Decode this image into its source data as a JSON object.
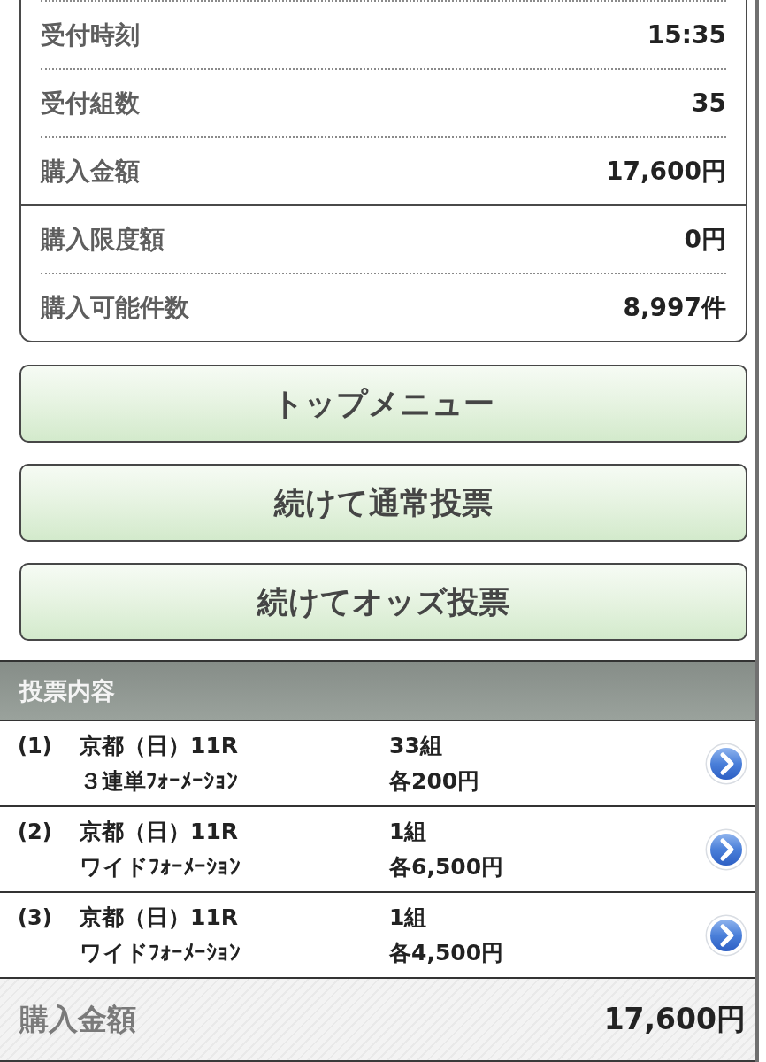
{
  "summary": {
    "sections": [
      {
        "rows": [
          {
            "label": "受付時刻",
            "value": "15:35"
          },
          {
            "label": "受付組数",
            "value": "35"
          },
          {
            "label": "購入金額",
            "value": "17,600円"
          }
        ]
      },
      {
        "rows": [
          {
            "label": "購入限度額",
            "value": "0円"
          },
          {
            "label": "購入可能件数",
            "value": "8,997件"
          }
        ]
      }
    ]
  },
  "buttons": [
    {
      "label": "トップメニュー"
    },
    {
      "label": "続けて通常投票"
    },
    {
      "label": "続けてオッズ投票"
    }
  ],
  "bets": {
    "title": "投票内容",
    "items": [
      {
        "number": "(1)",
        "race": "京都（日）11R",
        "bet_type": "３連単ﾌｫｰﾒｰｼｮﾝ",
        "combinations": "33組",
        "stake": "各200円"
      },
      {
        "number": "(2)",
        "race": "京都（日）11R",
        "bet_type": "ワイドﾌｫｰﾒｰｼｮﾝ",
        "combinations": "1組",
        "stake": "各6,500円"
      },
      {
        "number": "(3)",
        "race": "京都（日）11R",
        "bet_type": "ワイドﾌｫｰﾒｰｼｮﾝ",
        "combinations": "1組",
        "stake": "各4,500円"
      }
    ]
  },
  "total": {
    "label": "購入金額",
    "value": "17,600円"
  }
}
